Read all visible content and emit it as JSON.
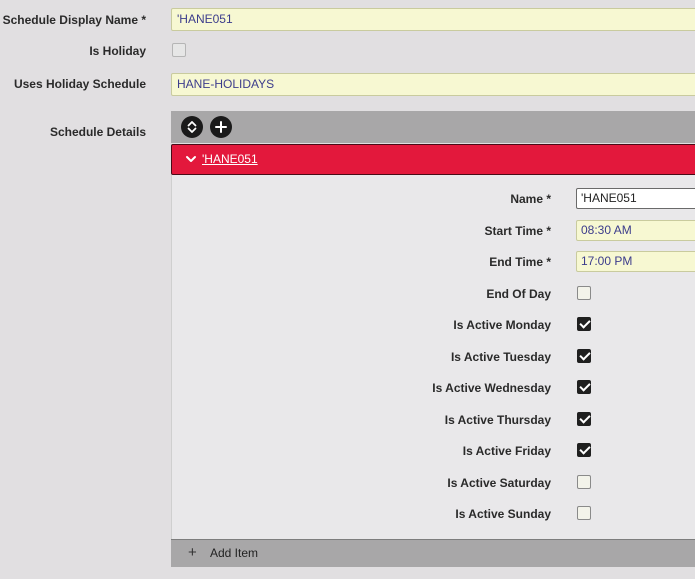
{
  "form": {
    "schedule_display_name": {
      "label": "Schedule Display Name *",
      "value": "'HANE051"
    },
    "is_holiday": {
      "label": "Is Holiday",
      "checked": false
    },
    "uses_holiday_schedule": {
      "label": "Uses Holiday Schedule",
      "value": "HANE-HOLIDAYS"
    },
    "schedule_details": {
      "label": "Schedule Details"
    }
  },
  "toolbar": {
    "reorder_icon": "chevron-up-down-icon",
    "add_icon": "plus-icon"
  },
  "item": {
    "title": "'HANE051",
    "name": {
      "label": "Name *",
      "value": "'HANE051"
    },
    "start_time": {
      "label": "Start Time *",
      "value": "08:30 AM"
    },
    "end_time": {
      "label": "End Time *",
      "value": "17:00 PM"
    },
    "end_of_day": {
      "label": "End Of Day",
      "checked": false
    },
    "days": [
      {
        "label": "Is Active Monday",
        "checked": true
      },
      {
        "label": "Is Active Tuesday",
        "checked": true
      },
      {
        "label": "Is Active Wednesday",
        "checked": true
      },
      {
        "label": "Is Active Thursday",
        "checked": true
      },
      {
        "label": "Is Active Friday",
        "checked": true
      },
      {
        "label": "Is Active Saturday",
        "checked": false
      },
      {
        "label": "Is Active Sunday",
        "checked": false
      }
    ]
  },
  "footer": {
    "add_label": "Add Item"
  },
  "colors": {
    "accent": "#e3183c",
    "field_bg": "#f7f8d2",
    "toolbar_bg": "#a8a7a8"
  }
}
